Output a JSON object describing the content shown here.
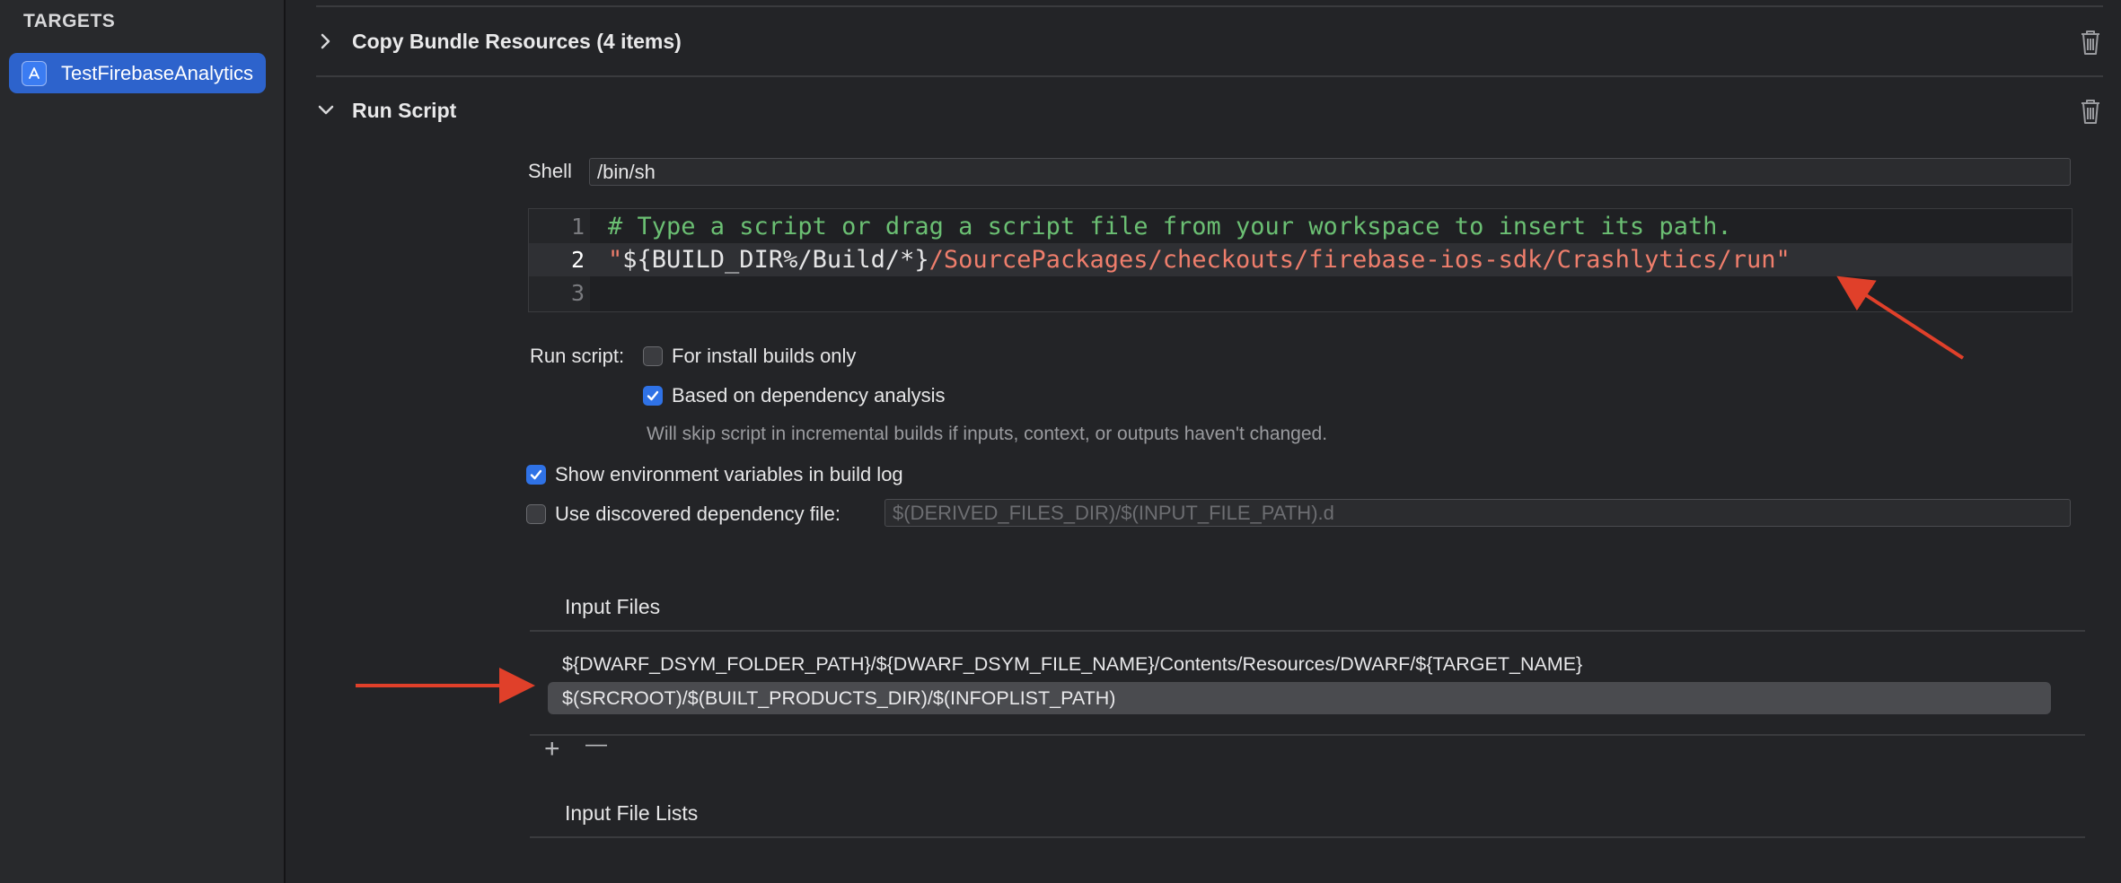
{
  "sidebar": {
    "header": "TARGETS",
    "target": {
      "label": "TestFirebaseAnalytics",
      "icon": "app-target-icon"
    }
  },
  "phases": {
    "copy_bundle": {
      "title": "Copy Bundle Resources (4 items)",
      "expanded": false
    },
    "run_script": {
      "title": "Run Script",
      "expanded": true
    }
  },
  "run_script": {
    "shell_label": "Shell",
    "shell_value": "/bin/sh",
    "editor": {
      "lines": [
        {
          "number": "1",
          "comment": "# Type a script or drag a script file from your workspace to insert its path."
        },
        {
          "number": "2",
          "quote_open": "\"",
          "var": "${BUILD_DIR%/Build/*}",
          "path": "/SourcePackages/checkouts/firebase-ios-sdk/Crashlytics/run\""
        },
        {
          "number": "3"
        }
      ]
    },
    "run_script_label": "Run script:",
    "install_builds_only": {
      "label": "For install builds only",
      "checked": false
    },
    "dependency_analysis": {
      "label": "Based on dependency analysis",
      "checked": true
    },
    "dependency_hint": "Will skip script in incremental builds if inputs, context, or outputs haven't changed.",
    "show_env_vars": {
      "label": "Show environment variables in build log",
      "checked": true
    },
    "discovered_dep": {
      "label": "Use discovered dependency file:",
      "checked": false,
      "placeholder": "$(DERIVED_FILES_DIR)/$(INPUT_FILE_PATH).d"
    }
  },
  "input_files": {
    "title": "Input Files",
    "items": [
      "${DWARF_DSYM_FOLDER_PATH}/${DWARF_DSYM_FILE_NAME}/Contents/Resources/DWARF/${TARGET_NAME}",
      "$(SRCROOT)/$(BUILT_PRODUCTS_DIR)/$(INFOPLIST_PATH)"
    ],
    "selected_index": 1,
    "add_label": "+",
    "remove_label": "—"
  },
  "input_file_lists": {
    "title": "Input File Lists"
  },
  "colors": {
    "accent": "#2f72e6",
    "annotation_arrow": "#e0402a",
    "comment": "#6bbf73",
    "string": "#ef7e6c"
  }
}
